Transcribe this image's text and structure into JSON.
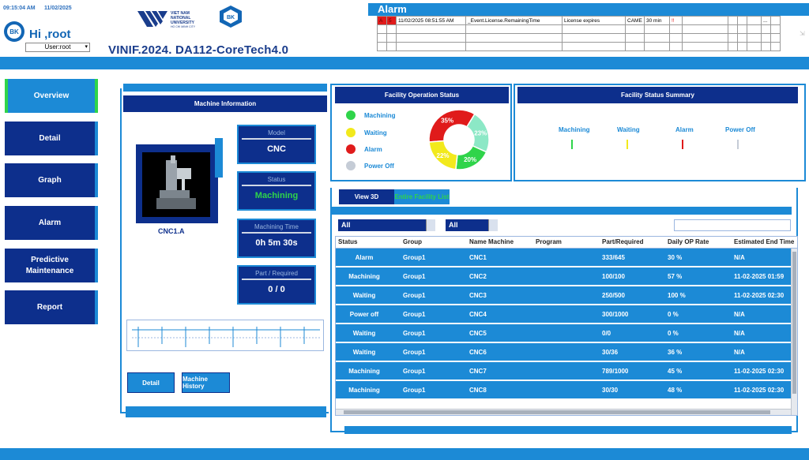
{
  "header": {
    "time": "09:15:04 AM",
    "date": "11/02/2025",
    "greeting": "Hi ,root",
    "user_select": "User:root",
    "project_title": "VINIF.2024. DA112-CoreTech4.0",
    "logo_bk_text": "BK",
    "logo_vnu_lines": [
      "VIET NAM",
      "NATIONAL",
      "UNIVERSITY",
      "HO CHI MINH CITY"
    ]
  },
  "alarm": {
    "title": "Alarm",
    "row": {
      "flag": "A",
      "code": "5",
      "timestamp": "11/02/2025 08:51:55 AM",
      "tag": "_Event.License.RemainingTime",
      "message": "License expires",
      "source": "CAME",
      "value": "30 min",
      "marker": "!!",
      "more": "..."
    }
  },
  "nav": {
    "items": [
      {
        "label": "Overview"
      },
      {
        "label": "Detail"
      },
      {
        "label": "Graph"
      },
      {
        "label": "Alarm"
      },
      {
        "label": "Predictive Maintenance"
      },
      {
        "label": "Report"
      }
    ]
  },
  "machine_info": {
    "title": "Machine Information",
    "machine_name": "CNC1.A",
    "model_label": "Model",
    "model_value": "CNC",
    "status_label": "Status",
    "status_value": "Machining",
    "time_label": "Machining Time",
    "time_value": "0h 5m 30s",
    "part_label": "Part / Required",
    "part_value": "0 / 0",
    "detail_button": "Detail",
    "history_button": "Machine History"
  },
  "operation_status": {
    "title": "Facility Operation Status",
    "legend": [
      {
        "label": "Machining",
        "color": "#2fd44a"
      },
      {
        "label": "Waiting",
        "color": "#f2e91c"
      },
      {
        "label": "Alarm",
        "color": "#e01b1b"
      },
      {
        "label": "Power Off",
        "color": "#c5ccd6"
      }
    ],
    "donut": [
      {
        "label": "35%",
        "value": 35,
        "color": "#e01b1b"
      },
      {
        "label": "23%",
        "value": 23,
        "color": "#8ce8c6"
      },
      {
        "label": "20%",
        "value": 20,
        "color": "#2fd44a"
      },
      {
        "label": "22%",
        "value": 22,
        "color": "#f2e91c"
      }
    ]
  },
  "status_summary": {
    "title": "Facility Status Summary",
    "items": [
      {
        "label": "Machining",
        "color": "#2fd44a"
      },
      {
        "label": "Waiting",
        "color": "#f2e91c"
      },
      {
        "label": "Alarm",
        "color": "#e01b1b"
      },
      {
        "label": "Power Off",
        "color": "#c5ccd6"
      }
    ]
  },
  "facility_list": {
    "tabs": [
      "View 3D",
      "Entire Facility List"
    ],
    "filter1": "All",
    "filter2": "All",
    "columns": [
      "Status",
      "Group",
      "Name Machine",
      "Program",
      "Part/Required",
      "Daily OP Rate",
      "Estimated End Time"
    ],
    "rows": [
      [
        "Alarm",
        "Group1",
        "CNC1",
        "",
        "333/645",
        "30 %",
        "N/A"
      ],
      [
        "Machining",
        "Group1",
        "CNC2",
        "",
        "100/100",
        "57 %",
        "11-02-2025 01:59"
      ],
      [
        "Waiting",
        "Group1",
        "CNC3",
        "",
        "250/500",
        "100 %",
        "11-02-2025 02:30"
      ],
      [
        "Power off",
        "Group1",
        "CNC4",
        "",
        "300/1000",
        "0 %",
        "N/A"
      ],
      [
        "Waiting",
        "Group1",
        "CNC5",
        "",
        "0/0",
        "0 %",
        "N/A"
      ],
      [
        "Waiting",
        "Group1",
        "CNC6",
        "",
        "30/36",
        "36 %",
        "N/A"
      ],
      [
        "Machining",
        "Group1",
        "CNC7",
        "",
        "789/1000",
        "45 %",
        "11-02-2025 02:30"
      ],
      [
        "Machining",
        "Group1",
        "CNC8",
        "",
        "30/30",
        "48 %",
        "11-02-2025 02:30"
      ]
    ]
  }
}
